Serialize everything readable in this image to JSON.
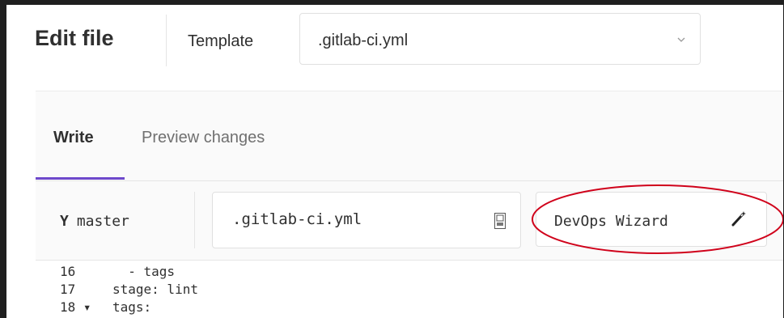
{
  "header": {
    "title": "Edit file",
    "template_label": "Template",
    "template_value": ".gitlab-ci.yml"
  },
  "tabs": [
    {
      "label": "Write",
      "active": true
    },
    {
      "label": "Preview changes",
      "active": false
    }
  ],
  "file_header": {
    "branch_icon": "Y",
    "branch": "master",
    "filename": ".gitlab-ci.yml",
    "wizard_label": "DevOps Wizard"
  },
  "code_lines": [
    {
      "number": "16",
      "fold": "",
      "text": "  - tags"
    },
    {
      "number": "17",
      "fold": "",
      "text": "stage: lint"
    },
    {
      "number": "18",
      "fold": "▾",
      "text": "tags:"
    }
  ],
  "colors": {
    "active_tab_underline": "#6e49cb",
    "annotation_circle": "#d0021b"
  },
  "icons": {
    "template_dropdown": "chevron-down-icon",
    "branch": "git-branch-icon",
    "file": "file-icon",
    "wizard": "magic-wand-icon"
  }
}
